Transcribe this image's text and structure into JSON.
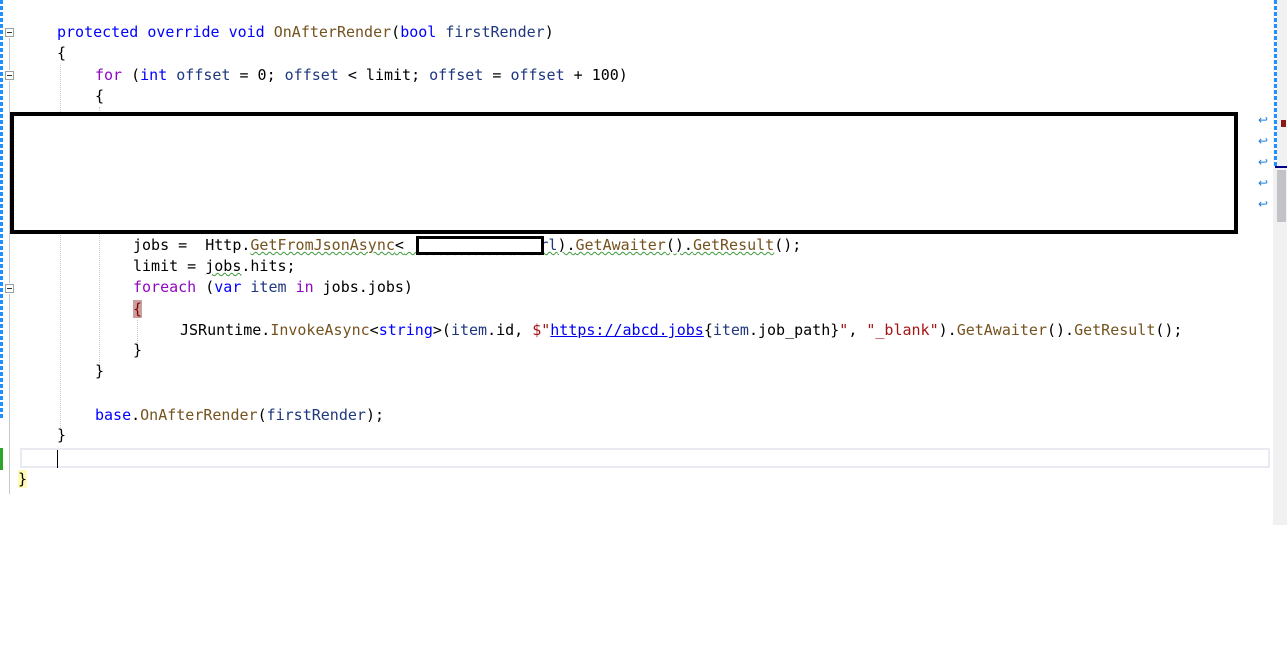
{
  "code": {
    "l1": {
      "kw1": "protected",
      "kw2": "override",
      "kw3": "void",
      "method": "OnAfterRender",
      "paren_open": "(",
      "type": "bool",
      "param": "firstRender",
      "paren_close": ")"
    },
    "l2": "{",
    "l3": {
      "kw_for": "for",
      "p1": " (",
      "type_int": "int",
      "sp": " ",
      "v1": "offset",
      "t1": " = 0; ",
      "v2": "offset",
      "t2": " < limit; ",
      "v3": "offset",
      "t3": " = ",
      "v4": "offset",
      "t4": " + 100)"
    },
    "l4": "{",
    "l5": {
      "jobs": "jobs",
      "eq": " =  ",
      "http": "Http",
      "dot": ".",
      "getjson": "GetFromJsonAsync",
      "lt": "<",
      "gt": ">",
      "url_open": "(",
      "url_var": "url",
      "url_close": ").",
      "awaiter": "GetAwaiter",
      "paren": "().",
      "result": "GetResult",
      "end": "();"
    },
    "l6": {
      "limit": "limit = ",
      "jobs": "jobs",
      "hits": ".hits;"
    },
    "l7": {
      "foreach": "foreach",
      "p1": " (",
      "var": "var",
      "item": "item",
      "in": "in",
      "rest": " jobs.jobs)"
    },
    "l8": "{",
    "l9": {
      "js": "JSRuntime",
      "dot": ".",
      "invoke": "InvokeAsync",
      "lt": "<",
      "type": "string",
      "gt": ">(",
      "item1": "item",
      "id": ".id, ",
      "dollar": "$\"",
      "url": "https://abcd.jobs",
      "brace_open": "{",
      "item2": "item",
      "jobpath": ".job_path}",
      "quote": "\"",
      "comma": ", ",
      "blank": "\"_blank\"",
      "close": ").",
      "awaiter": "GetAwaiter",
      "paren": "().",
      "result": "GetResult",
      "end": "();"
    },
    "l10": "}",
    "l11": "}",
    "l12": {
      "base": "base",
      "dot": ".",
      "method": "OnAfterRender",
      "open": "(",
      "param": "firstRender",
      "close": ");"
    },
    "l13": "}",
    "l15": "}"
  },
  "colors": {
    "keyword": "#0000ff",
    "control_keyword": "#8f08c4",
    "method": "#74531f",
    "variable": "#1f377f",
    "string": "#a31515",
    "type": "#2b91af"
  },
  "icons": [
    "fold-collapse-icon",
    "word-wrap-icon"
  ]
}
